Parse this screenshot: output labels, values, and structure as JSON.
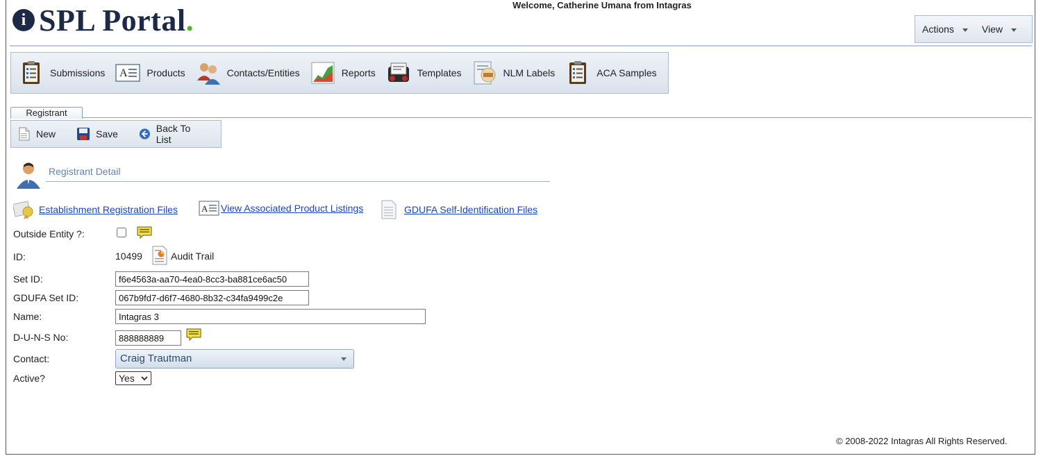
{
  "app": {
    "logo_text": "SPL Portal",
    "logo_dot": ".",
    "logo_badge": "i",
    "welcome": "Welcome, Catherine Umana from Intagras"
  },
  "top_menu": {
    "actions_label": "Actions",
    "view_label": "View"
  },
  "main_nav": [
    {
      "label": "Submissions",
      "icon": "clipboard-icon"
    },
    {
      "label": "Products",
      "icon": "product-card-icon"
    },
    {
      "label": "Contacts/Entities",
      "icon": "people-icon"
    },
    {
      "label": "Reports",
      "icon": "chart-icon"
    },
    {
      "label": "Templates",
      "icon": "rolodex-icon"
    },
    {
      "label": "NLM Labels",
      "icon": "label-icon"
    },
    {
      "label": "ACA Samples",
      "icon": "clipboard-icon"
    }
  ],
  "tab": {
    "label": "Registrant"
  },
  "toolbar": {
    "new_label": "New",
    "save_label": "Save",
    "back_label": "Back To List"
  },
  "section": {
    "title": "Registrant Detail"
  },
  "links": {
    "establishment": "Establishment Registration Files",
    "product_listings": "View Associated Product Listings",
    "gdufa": "GDUFA Self-Identification Files"
  },
  "form": {
    "outside_entity_label": "Outside Entity ?:",
    "outside_entity_checked": false,
    "id_label": "ID:",
    "id_value": "10499",
    "audit_trail_label": "Audit Trail",
    "set_id_label": "Set ID:",
    "set_id_value": "f6e4563a-aa70-4ea0-8cc3-ba881ce6ac50",
    "gdufa_set_id_label": "GDUFA Set ID:",
    "gdufa_set_id_value": "067b9fd7-d6f7-4680-8b32-c34fa9499c2e",
    "name_label": "Name:",
    "name_value": "Intagras 3",
    "duns_label": "D-U-N-S No:",
    "duns_value": "888888889",
    "contact_label": "Contact:",
    "contact_value": "Craig Trautman",
    "active_label": "Active?",
    "active_value": "Yes"
  },
  "footer": {
    "copyright": "© 2008-2022 Intagras All Rights Reserved."
  }
}
